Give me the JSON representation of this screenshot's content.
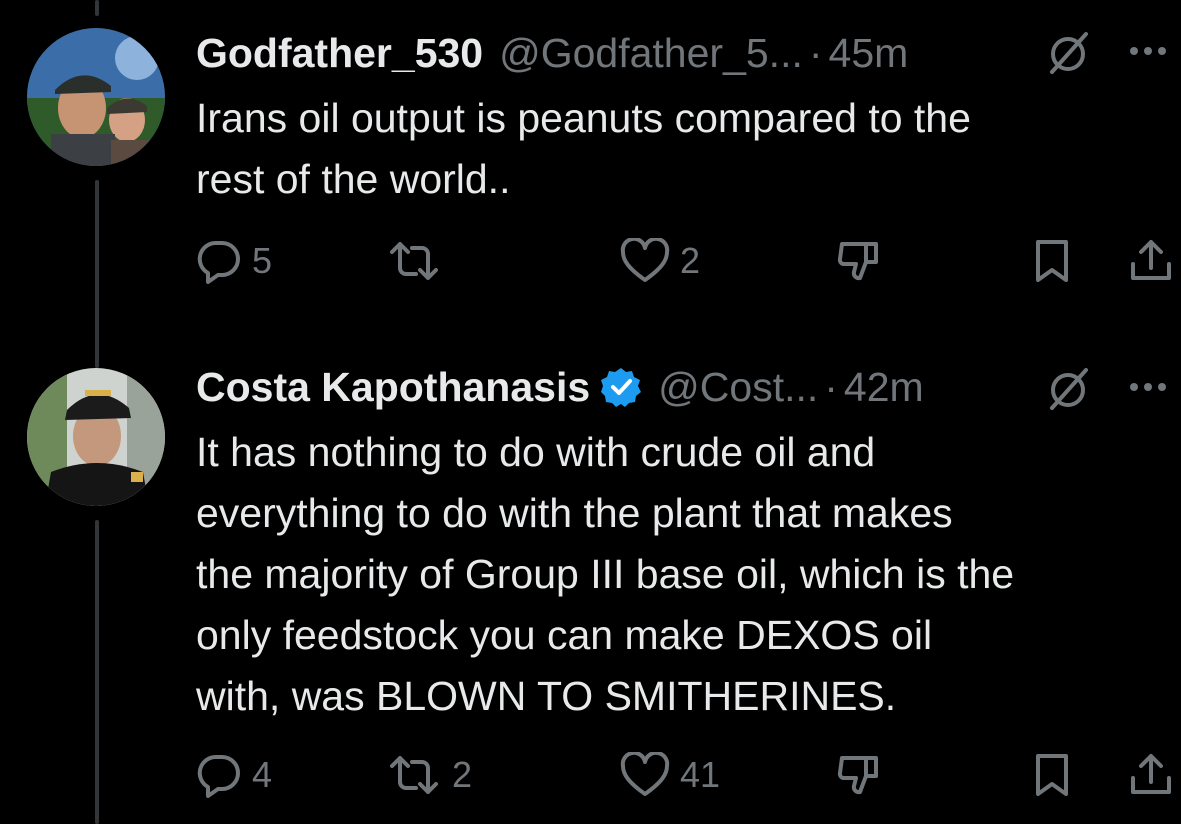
{
  "tweets": [
    {
      "name": "Godfather_530",
      "handle": "@Godfather_5...",
      "time": "45m",
      "text_lines": [
        "Irans oil output is peanuts compared to the",
        "rest of the world.."
      ],
      "replies": "5",
      "reposts": "",
      "likes": "2",
      "verified": false
    },
    {
      "name": "Costa Kapothanasis",
      "handle": "@Cost...",
      "time": "42m",
      "text_lines": [
        "It has nothing to do with crude oil and",
        "everything to do with the plant that makes",
        "the majority of Group III base oil, which is the",
        "only feedstock you can make DEXOS oil",
        "with, was BLOWN TO SMITHERINES."
      ],
      "replies": "4",
      "reposts": "2",
      "likes": "41",
      "verified": true
    }
  ],
  "separator": "·",
  "icons": {
    "reply": "reply-icon",
    "repost": "repost-icon",
    "like": "like-icon",
    "dislike": "dislike-icon",
    "bookmark": "bookmark-icon",
    "share": "share-icon",
    "grok": "grok-icon",
    "more": "more-icon",
    "verified": "verified-badge-icon"
  },
  "colors": {
    "background": "#000000",
    "text": "#e7e9ea",
    "muted": "#71767b",
    "verified": "#1d9bf0",
    "thread_line": "#333639"
  }
}
